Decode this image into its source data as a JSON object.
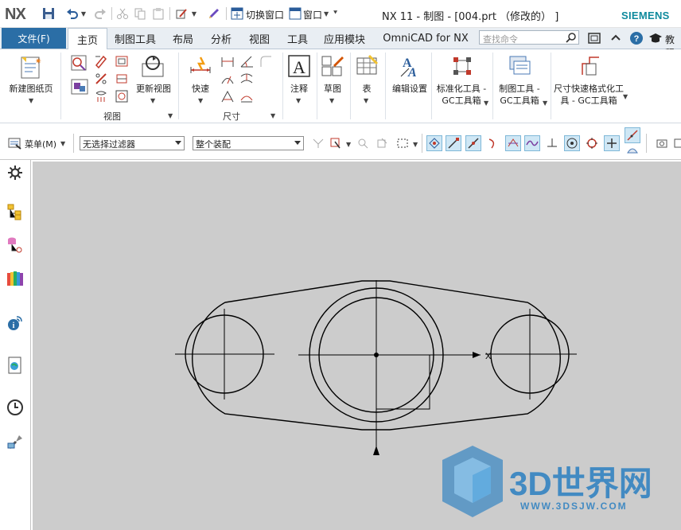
{
  "app": {
    "logo": "NX",
    "title": "NX 11 - 制图 - [004.prt （修改的） ]",
    "brand": "SIEMENS",
    "brand_color": "#0f8a9d"
  },
  "quick_access": {
    "switch_window": "切换窗口",
    "window": "窗口"
  },
  "menu_tabs": {
    "file": "文件(F)",
    "items": [
      "主页",
      "制图工具",
      "布局",
      "分析",
      "视图",
      "工具",
      "应用模块",
      "OmniCAD for NX"
    ],
    "active_index": 0,
    "search_placeholder": "查找命令",
    "teach": "教程"
  },
  "ribbon": {
    "new_sheet": "新建图纸页",
    "view_group": "视图",
    "update_view": "更新视图",
    "rapid_dim": "快速",
    "dim_group": "尺寸",
    "note": "注释",
    "sketch": "草图",
    "table": "表",
    "edit_settings": "编辑设置",
    "std_tools_line1": "标准化工具 -",
    "std_tools_line2": "GC工具箱",
    "draft_tools_line1": "制图工具 -",
    "draft_tools_line2": "GC工具箱",
    "dim_format_line1": "尺寸快速格式化工",
    "dim_format_line2": "具 - GC工具箱"
  },
  "command_bar": {
    "menu": "菜单(M)",
    "filter": "无选择过滤器",
    "assembly": "整个装配"
  },
  "drawing": {
    "axis_label": "X"
  },
  "watermark": {
    "name": "3D世界网",
    "url": "WWW.3DSJW.COM",
    "color": "#2a7fc1"
  }
}
